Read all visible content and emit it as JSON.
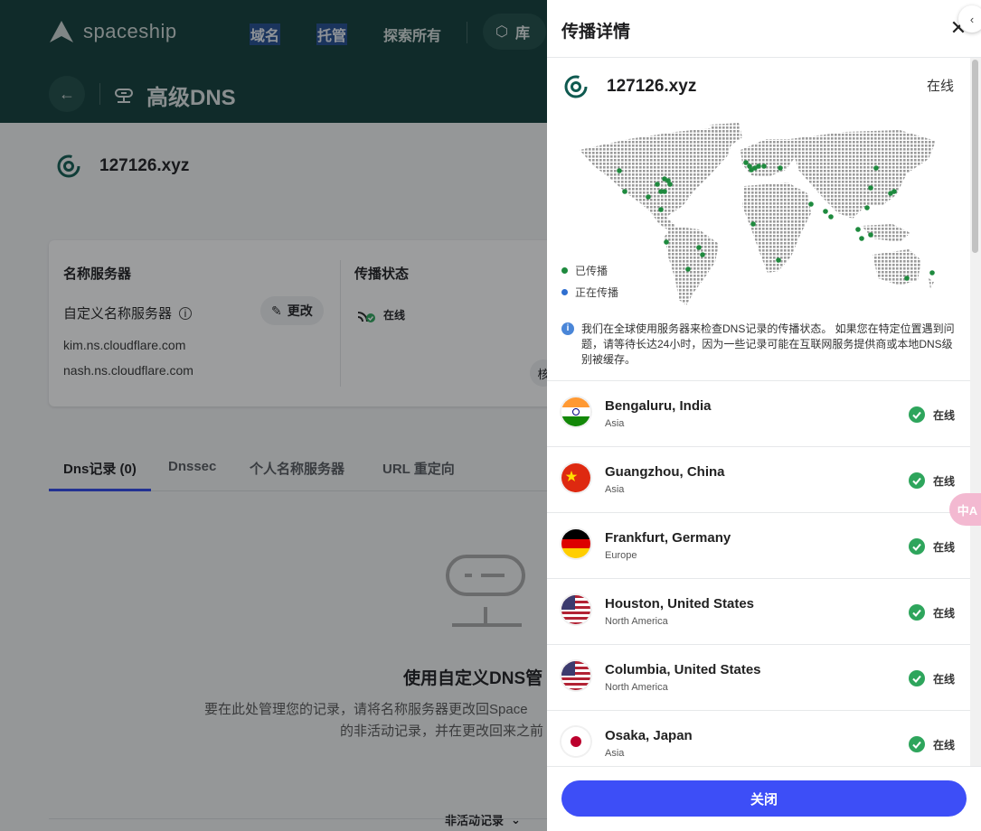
{
  "brand": {
    "name": "spaceship"
  },
  "nav": {
    "items": [
      "域名",
      "托管",
      "探索所有"
    ],
    "library": "库"
  },
  "page": {
    "title": "高级DNS",
    "domain": "127126.xyz"
  },
  "card": {
    "ns_heading": "名称服务器",
    "custom_ns_label": "自定义名称服务器",
    "edit_label": "更改",
    "nameservers": [
      "kim.ns.cloudflare.com",
      "nash.ns.cloudflare.com"
    ],
    "prop_heading": "传播状态",
    "prop_status": "在线",
    "mini_btn": "核"
  },
  "tabs": [
    "Dns记录 (0)",
    "Dnssec",
    "个人名称服务器",
    "URL 重定向"
  ],
  "empty": {
    "title": "使用自定义DNS管",
    "desc1": "要在此处管理您的记录，请将名称服务器更改回Space",
    "desc2": "的非活动记录，并在更改回来之前"
  },
  "inactive_selector": "非活动记录",
  "drawer": {
    "title": "传播详情",
    "domain": "127126.xyz",
    "domain_status": "在线",
    "legend": {
      "propagated": "已传播",
      "propagating": "正在传播"
    },
    "colors": {
      "propagated": "#1e8a3e",
      "propagating": "#2f6fd0",
      "accent": "#3d4ef7"
    },
    "info": "我们在全球使用服务器来检查DNS记录的传播状态。 如果您在特定位置遇到问题，请等待长达24小时，因为一些记录可能在互联网服务提供商或本地DNS级别被缓存。",
    "locations": [
      {
        "name": "Bengaluru, India",
        "region": "Asia",
        "status": "在线",
        "flag": "india-flag-icon"
      },
      {
        "name": "Guangzhou, China",
        "region": "Asia",
        "status": "在线",
        "flag": "china-flag-icon"
      },
      {
        "name": "Frankfurt, Germany",
        "region": "Europe",
        "status": "在线",
        "flag": "germany-flag-icon"
      },
      {
        "name": "Houston, United States",
        "region": "North America",
        "status": "在线",
        "flag": "usa-flag-icon"
      },
      {
        "name": "Columbia, United States",
        "region": "North America",
        "status": "在线",
        "flag": "usa-flag-icon"
      },
      {
        "name": "Osaka, Japan",
        "region": "Asia",
        "status": "在线",
        "flag": "japan-flag-icon"
      }
    ],
    "close_label": "关闭"
  },
  "translate_label": "中A"
}
